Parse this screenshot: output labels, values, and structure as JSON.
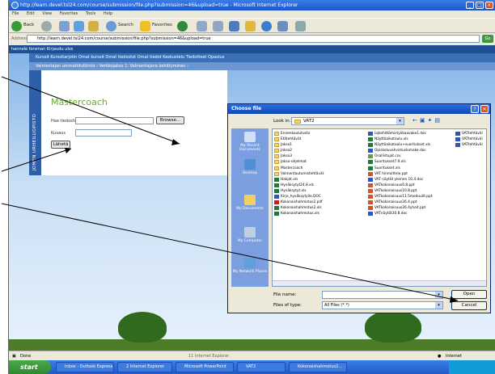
{
  "window": {
    "title": "http://learn.devel.tsl24.com/course/submission/file.php?submission=46&upload=true - Microsoft Internet Explorer",
    "menu": [
      "File",
      "Edit",
      "View",
      "Favorites",
      "Tools",
      "Help"
    ]
  },
  "toolbar": {
    "back": "Back",
    "search": "Search",
    "favorites": "Favorites"
  },
  "address": {
    "label": "Address",
    "url": "http://learn.devel.tsl24.com/course/submission/file.php?submission=46&upload=true",
    "go": "Go"
  },
  "site": {
    "user_line": "hannele forsman Kirjaudu ulos",
    "nav_main": "Kurssit Kurssitarjotin Omat kurssit Omat tiedostot Omat tiedot Keskustelu Tiedotteet Opastus",
    "breadcrumb": "Valmentajan ammattitutkinto › Verkkojakso 1: Valmentajana kehittyminen ›",
    "school": "JOMEN URHEILUOPISTO",
    "course_title": "Mastercoach",
    "file_label": "Hae tiedosto",
    "browse": "Browse...",
    "comment_label": "Kuvaus",
    "send": "Lähetä"
  },
  "dialog": {
    "title": "Choose file",
    "lookin_label": "Look in:",
    "lookin_value": "VAT2",
    "places": [
      "My Recent Documents",
      "Desktop",
      "My Documents",
      "My Computer",
      "My Network Places"
    ],
    "files_col1": [
      {
        "name": "Ennenkoulutusta",
        "type": "folder"
      },
      {
        "name": "Etätehtävät",
        "type": "folder"
      },
      {
        "name": "Jakso1",
        "type": "folder"
      },
      {
        "name": "Jakso2",
        "type": "folder"
      },
      {
        "name": "Jakso3",
        "type": "folder"
      },
      {
        "name": "Jakso-ohjelmat",
        "type": "folder"
      },
      {
        "name": "Mastercoach",
        "type": "folder"
      },
      {
        "name": "Valmentautumistehtävät",
        "type": "folder"
      },
      {
        "name": "Hakjat.xls",
        "type": "xls"
      },
      {
        "name": "Hyväksytyt24.8.xls",
        "type": "xls"
      },
      {
        "name": "Hyväksytyt.xls",
        "type": "xls"
      },
      {
        "name": "Kirje_hyväksytylle.DOC",
        "type": "doc"
      },
      {
        "name": "Kokonaishahmotus2.pdf",
        "type": "pdf"
      },
      {
        "name": "Kokonaishahmotus2.xls",
        "type": "xls"
      },
      {
        "name": "Kokonaishahmotus.xls",
        "type": "xls"
      }
    ],
    "files_col2": [
      {
        "name": "lajkehittämistyökaavake1.doc",
        "type": "doc"
      },
      {
        "name": "Näyttöaikataulu.xls",
        "type": "xls"
      },
      {
        "name": "Näyttöaikataulu+suoritukset.xls",
        "type": "xls"
      },
      {
        "name": "Opiskeluvahvistuslomake.doc",
        "type": "doc"
      },
      {
        "name": "Osallistujat.csv",
        "type": "csv"
      },
      {
        "name": "Suoritukset7.9.xls",
        "type": "xls"
      },
      {
        "name": "Suoritukset.xls",
        "type": "xls"
      },
      {
        "name": "VAT hinnoittelu.ppt",
        "type": "ppt"
      },
      {
        "name": "VAT näytöt yleinen 10.4.doc",
        "type": "doc"
      },
      {
        "name": "VATkokonaisuus6.8.ppt",
        "type": "ppt"
      },
      {
        "name": "VATkokonaisuus10.8.ppt",
        "type": "ppt"
      },
      {
        "name": "VATkokonaisuus11.5moduulit.ppt",
        "type": "ppt"
      },
      {
        "name": "VATkokonaisuus26.4.ppt",
        "type": "ppt"
      },
      {
        "name": "VATkokonaisuus26.4yhoit.ppt",
        "type": "ppt"
      },
      {
        "name": "VATnäytöt30.8.doc",
        "type": "doc"
      }
    ],
    "files_col3": [
      {
        "name": "VATtehtäväl",
        "type": "doc"
      },
      {
        "name": "VATtehtäväl",
        "type": "doc"
      },
      {
        "name": "VATtehtäväl",
        "type": "doc"
      }
    ],
    "filename_label": "File name:",
    "filename_value": "",
    "filetype_label": "Files of type:",
    "filetype_value": "All Files (*.*)",
    "open": "Open",
    "cancel": "Cancel"
  },
  "status": {
    "left": "Done",
    "middle": "11 Internet Explorer",
    "zone": "Internet"
  },
  "taskbar": {
    "start": "start",
    "tasks": [
      "Inbox - Outlook Express",
      "2 Internet Explorer",
      "Microsoft PowerPoint",
      "VAT2",
      "Kokonaishahmotus2..."
    ]
  }
}
